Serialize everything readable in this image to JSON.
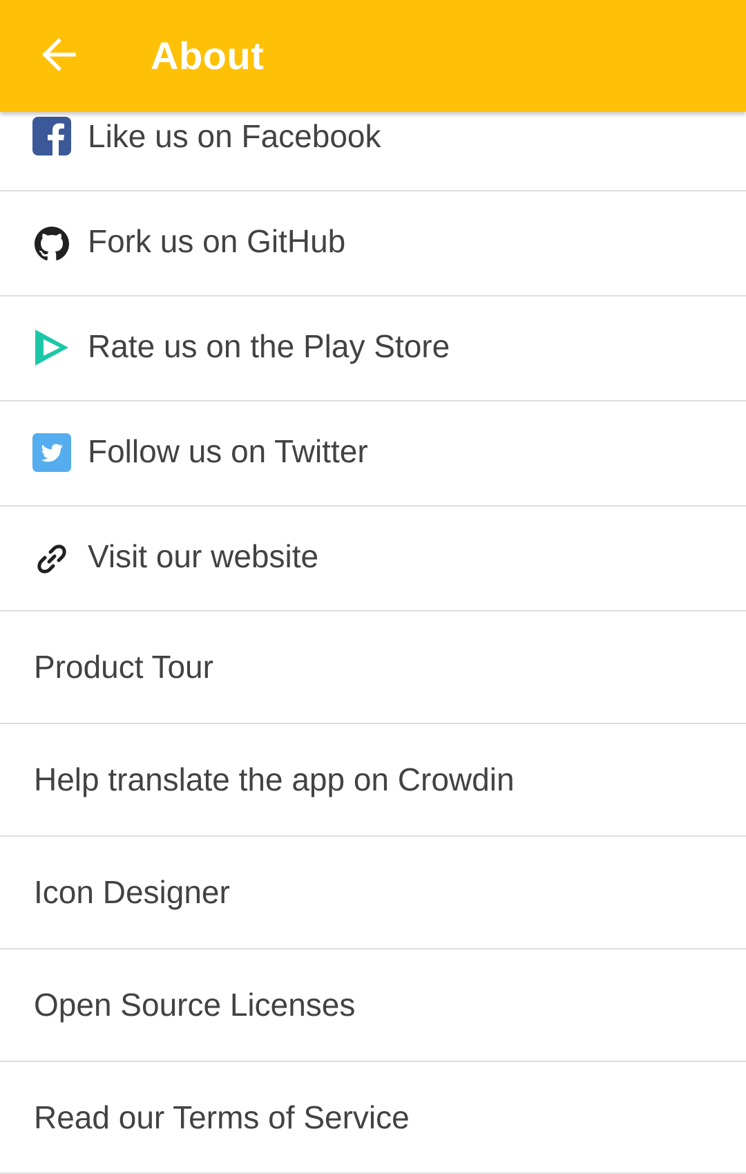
{
  "toolbar": {
    "title": "About",
    "background_color": "#FFC107"
  },
  "social_items": [
    {
      "label": "Like us on Facebook",
      "icon": "facebook-icon",
      "color": "#3B5998"
    },
    {
      "label": "Fork us on GitHub",
      "icon": "github-icon",
      "color": "#212121"
    },
    {
      "label": "Rate us on the Play Store",
      "icon": "play-store-icon",
      "color": "#1CC7A7"
    },
    {
      "label": "Follow us on Twitter",
      "icon": "twitter-icon",
      "color": "#55ACEE"
    },
    {
      "label": "Visit our website",
      "icon": "link-icon",
      "color": "#212121"
    }
  ],
  "items": [
    {
      "label": "Product Tour"
    },
    {
      "label": "Help translate the app on Crowdin"
    },
    {
      "label": "Icon Designer"
    },
    {
      "label": "Open Source Licenses"
    },
    {
      "label": "Read our Terms of Service"
    }
  ]
}
